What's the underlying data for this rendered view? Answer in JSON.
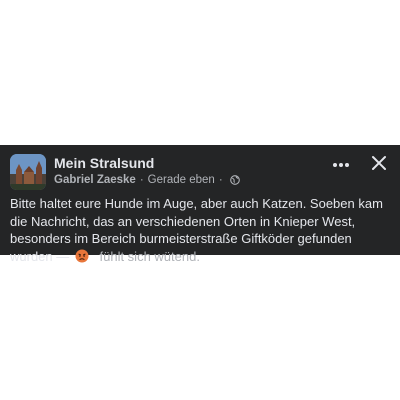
{
  "post": {
    "group_name": "Mein Stralsund",
    "author": "Gabriel Zaeske",
    "separator": "·",
    "timestamp": "Gerade eben",
    "privacy_separator": "·",
    "privacy_icon": "globe-icon",
    "more_icon": "more-dots-icon",
    "close_icon": "close-icon",
    "body": "Bitte haltet eure Hunde im Auge, aber auch Katzen. Soeben kam die Nachricht, das an verschiedenen Orten in Knieper West, besonders im Bereich burmeisterstraße Giftköder gefunden wurden —",
    "feeling_emoji": "😠",
    "feeling_text": "fühlt sich wütend."
  },
  "colors": {
    "card_background": "#242526",
    "primary_text": "#e4e6eb",
    "secondary_text": "#b0b3b8",
    "emoji_fill": "#e8763a"
  }
}
